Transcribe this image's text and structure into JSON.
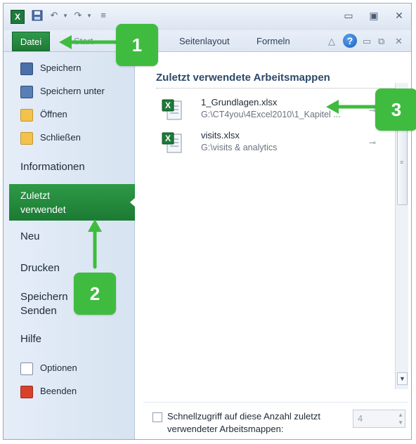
{
  "window": {
    "app_icon_letter": "X",
    "controls": {
      "minimize": "▭",
      "restore": "▣",
      "close": "✕"
    }
  },
  "qat": {
    "save_icon": "save-icon",
    "undo_icon": "undo-icon",
    "redo_icon": "redo-icon"
  },
  "ribbon": {
    "file_tab": "Datei",
    "tab_start_partial": "Start",
    "tabs": [
      "Seitenlayout",
      "Formeln"
    ],
    "help_label": "?"
  },
  "sidebar": {
    "save": "Speichern",
    "save_as": "Speichern unter",
    "open": "Öffnen",
    "close": "Schließen",
    "info": "Informationen",
    "recent_line1": "Zuletzt",
    "recent_line2": "verwendet",
    "new": "Neu",
    "print": "Drucken",
    "share_line1": "Speichern",
    "share_line2": "Senden",
    "help": "Hilfe",
    "options": "Optionen",
    "exit": "Beenden"
  },
  "main": {
    "heading": "Zuletzt verwendete Arbeitsmappen",
    "files": [
      {
        "name": "1_Grundlagen.xlsx",
        "path": "G:\\CT4you\\4Excel2010\\1_Kapitel  ..."
      },
      {
        "name": "visits.xlsx",
        "path": "G:\\visits & analytics"
      }
    ],
    "quick_access_line1": "Schnellzugriff auf diese Anzahl zuletzt",
    "quick_access_line2": "verwendeter Arbeitsmappen:",
    "quick_access_count": "4"
  },
  "callouts": [
    "1",
    "2",
    "3"
  ],
  "colors": {
    "accent_green": "#1d7a35",
    "callout_green": "#3fbc3f",
    "heading_blue": "#2d4a6a"
  }
}
